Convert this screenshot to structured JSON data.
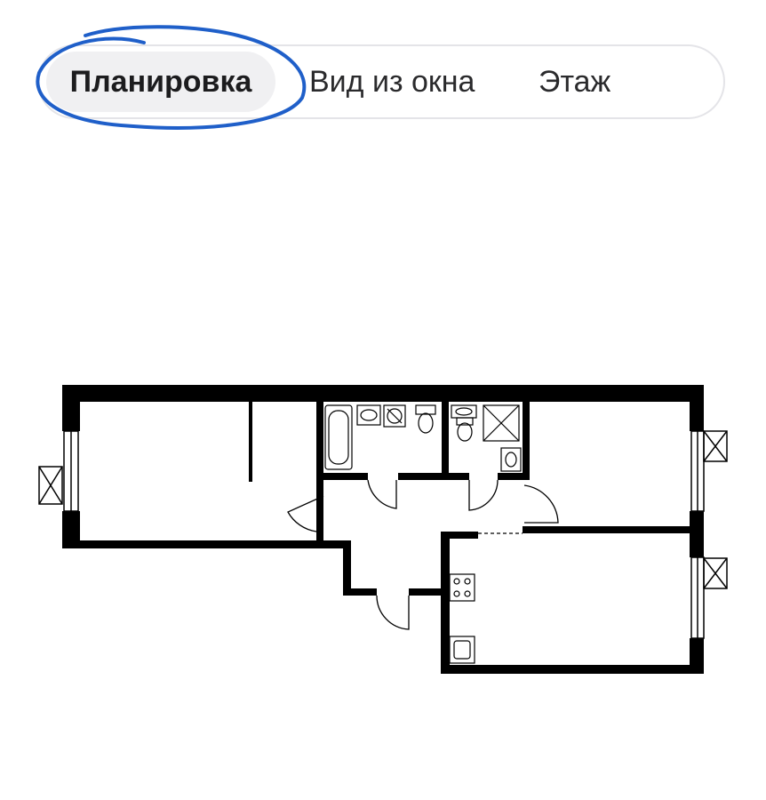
{
  "tabs": [
    {
      "label": "Планировка",
      "active": true
    },
    {
      "label": "Вид из окна",
      "active": false
    },
    {
      "label": "Этаж",
      "active": false
    }
  ],
  "colors": {
    "annotation": "#1f5fc9",
    "wall": "#000000",
    "active_tab_bg": "#f0f0f2",
    "border": "#e4e4e8"
  },
  "floor_plan": {
    "icons": [
      "bathtub-icon",
      "sink-icon",
      "washing-machine-icon",
      "toilet-icon",
      "shower-icon",
      "stove-icon",
      "kitchen-sink-icon",
      "window-icon"
    ]
  }
}
